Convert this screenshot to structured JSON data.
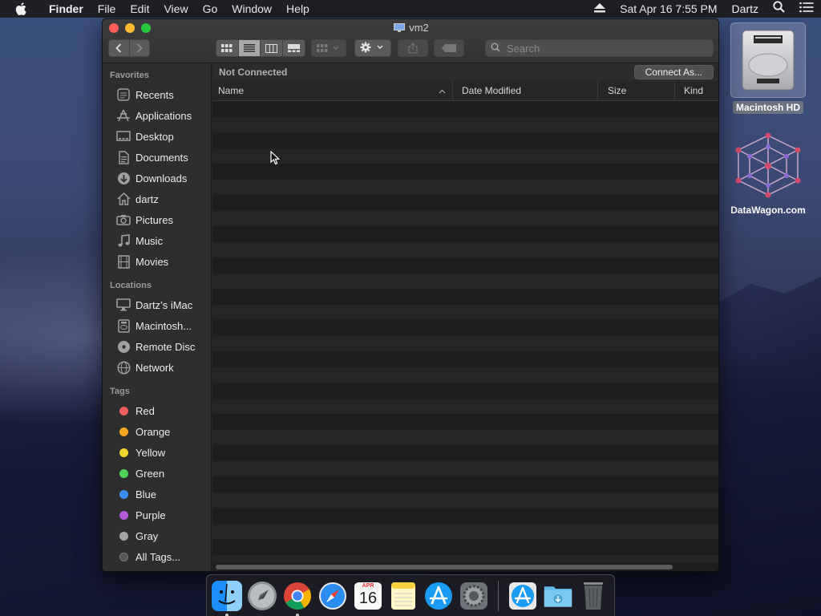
{
  "menubar": {
    "app_name": "Finder",
    "menus": [
      "File",
      "Edit",
      "View",
      "Go",
      "Window",
      "Help"
    ],
    "clock": "Sat Apr 16  7:55 PM",
    "user": "Dartz"
  },
  "desktop": {
    "icons": [
      {
        "label": "Macintosh HD",
        "icon": "hard-drive-icon"
      },
      {
        "label": "DataWagon.com",
        "icon": "network-globe-icon"
      }
    ]
  },
  "window": {
    "title": "vm2",
    "search_placeholder": "Search",
    "status": "Not Connected",
    "connect_button": "Connect As...",
    "columns": [
      "Name",
      "Date Modified",
      "Size",
      "Kind"
    ],
    "active_view": "list"
  },
  "sidebar": {
    "favorites_heading": "Favorites",
    "favorites": [
      {
        "label": "Recents",
        "icon": "clock-icon"
      },
      {
        "label": "Applications",
        "icon": "applications-icon"
      },
      {
        "label": "Desktop",
        "icon": "desktop-icon"
      },
      {
        "label": "Documents",
        "icon": "document-icon"
      },
      {
        "label": "Downloads",
        "icon": "download-icon"
      },
      {
        "label": "dartz",
        "icon": "home-icon"
      },
      {
        "label": "Pictures",
        "icon": "camera-icon"
      },
      {
        "label": "Music",
        "icon": "music-icon"
      },
      {
        "label": "Movies",
        "icon": "film-icon"
      }
    ],
    "locations_heading": "Locations",
    "locations": [
      {
        "label": "Dartz’s iMac",
        "icon": "imac-icon"
      },
      {
        "label": "Macintosh...",
        "icon": "hard-drive-icon"
      },
      {
        "label": "Remote Disc",
        "icon": "disc-icon"
      },
      {
        "label": "Network",
        "icon": "globe-icon"
      }
    ],
    "tags_heading": "Tags",
    "tags": [
      {
        "label": "Red",
        "color": "#ec5f5d"
      },
      {
        "label": "Orange",
        "color": "#f5a623"
      },
      {
        "label": "Yellow",
        "color": "#f3d52f"
      },
      {
        "label": "Green",
        "color": "#4fd35b"
      },
      {
        "label": "Blue",
        "color": "#3b8ef3"
      },
      {
        "label": "Purple",
        "color": "#b45bd8"
      },
      {
        "label": "Gray",
        "color": "#a5a5a5"
      },
      {
        "label": "All Tags...",
        "color": "#555555"
      }
    ]
  },
  "dock": {
    "apps": [
      "finder-icon",
      "launchpad-icon",
      "chrome-icon",
      "safari-icon",
      "calendar-icon",
      "notes-icon",
      "app-store-icon",
      "system-preferences-icon",
      "app-store-download-icon",
      "downloads-folder-icon",
      "trash-icon"
    ],
    "calendar_month": "APR",
    "calendar_day": "16"
  }
}
